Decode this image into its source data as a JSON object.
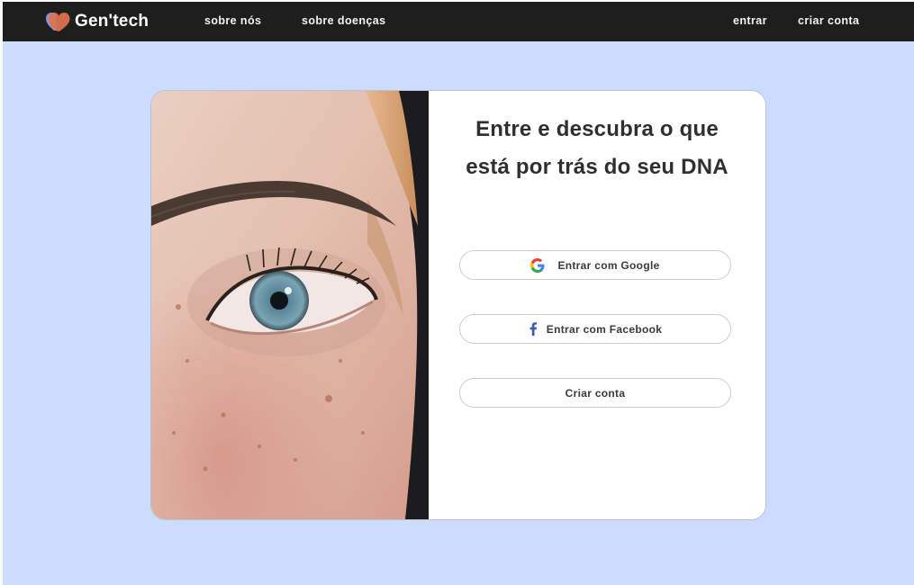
{
  "brand": {
    "name": "Gen'tech",
    "logo_icon": "heart-logo-icon",
    "colors": {
      "heart_blue": "#7b9be8",
      "heart_orange": "#e0734f"
    }
  },
  "nav": {
    "left_links": [
      "sobre nós",
      "sobre doenças"
    ],
    "right_links": [
      "entrar",
      "criar conta"
    ]
  },
  "login": {
    "headline_line1": "Entre e descubra o que",
    "headline_line2": "está por trás do seu DNA",
    "buttons": {
      "google": "Entrar com Google",
      "facebook": "Entrar com Facebook",
      "create": "Criar conta"
    },
    "icons": {
      "google": "google-icon",
      "facebook": "facebook-icon"
    }
  },
  "colors": {
    "navbar_bg": "#1e1e1e",
    "page_bg": "#ccdcfc",
    "card_bg": "#ffffff",
    "facebook_blue": "#3b5aa8"
  }
}
